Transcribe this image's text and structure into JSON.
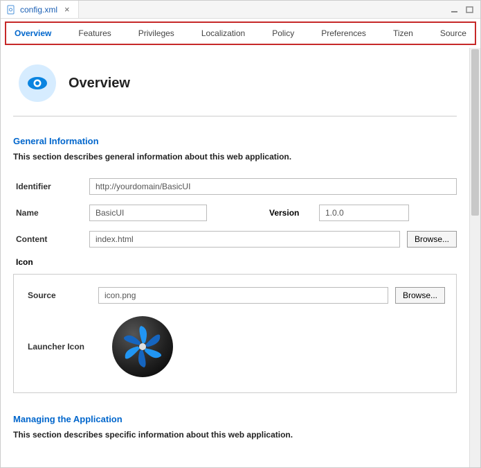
{
  "titlebar": {
    "file_name": "config.xml"
  },
  "tabs": [
    {
      "label": "Overview",
      "active": true
    },
    {
      "label": "Features",
      "active": false
    },
    {
      "label": "Privileges",
      "active": false
    },
    {
      "label": "Localization",
      "active": false
    },
    {
      "label": "Policy",
      "active": false
    },
    {
      "label": "Preferences",
      "active": false
    },
    {
      "label": "Tizen",
      "active": false
    },
    {
      "label": "Source",
      "active": false
    }
  ],
  "page": {
    "title": "Overview"
  },
  "general": {
    "heading": "General Information",
    "description": "This section describes general information about this web application.",
    "identifier_label": "Identifier",
    "identifier_value": "http://yourdomain/BasicUI",
    "name_label": "Name",
    "name_value": "BasicUI",
    "version_label": "Version",
    "version_value": "1.0.0",
    "content_label": "Content",
    "content_value": "index.html",
    "browse_label": "Browse..."
  },
  "icon": {
    "group_label": "Icon",
    "source_label": "Source",
    "source_value": "icon.png",
    "browse_label": "Browse...",
    "launcher_label": "Launcher Icon"
  },
  "managing": {
    "heading": "Managing the Application",
    "description": "This section describes specific information about this web application."
  }
}
